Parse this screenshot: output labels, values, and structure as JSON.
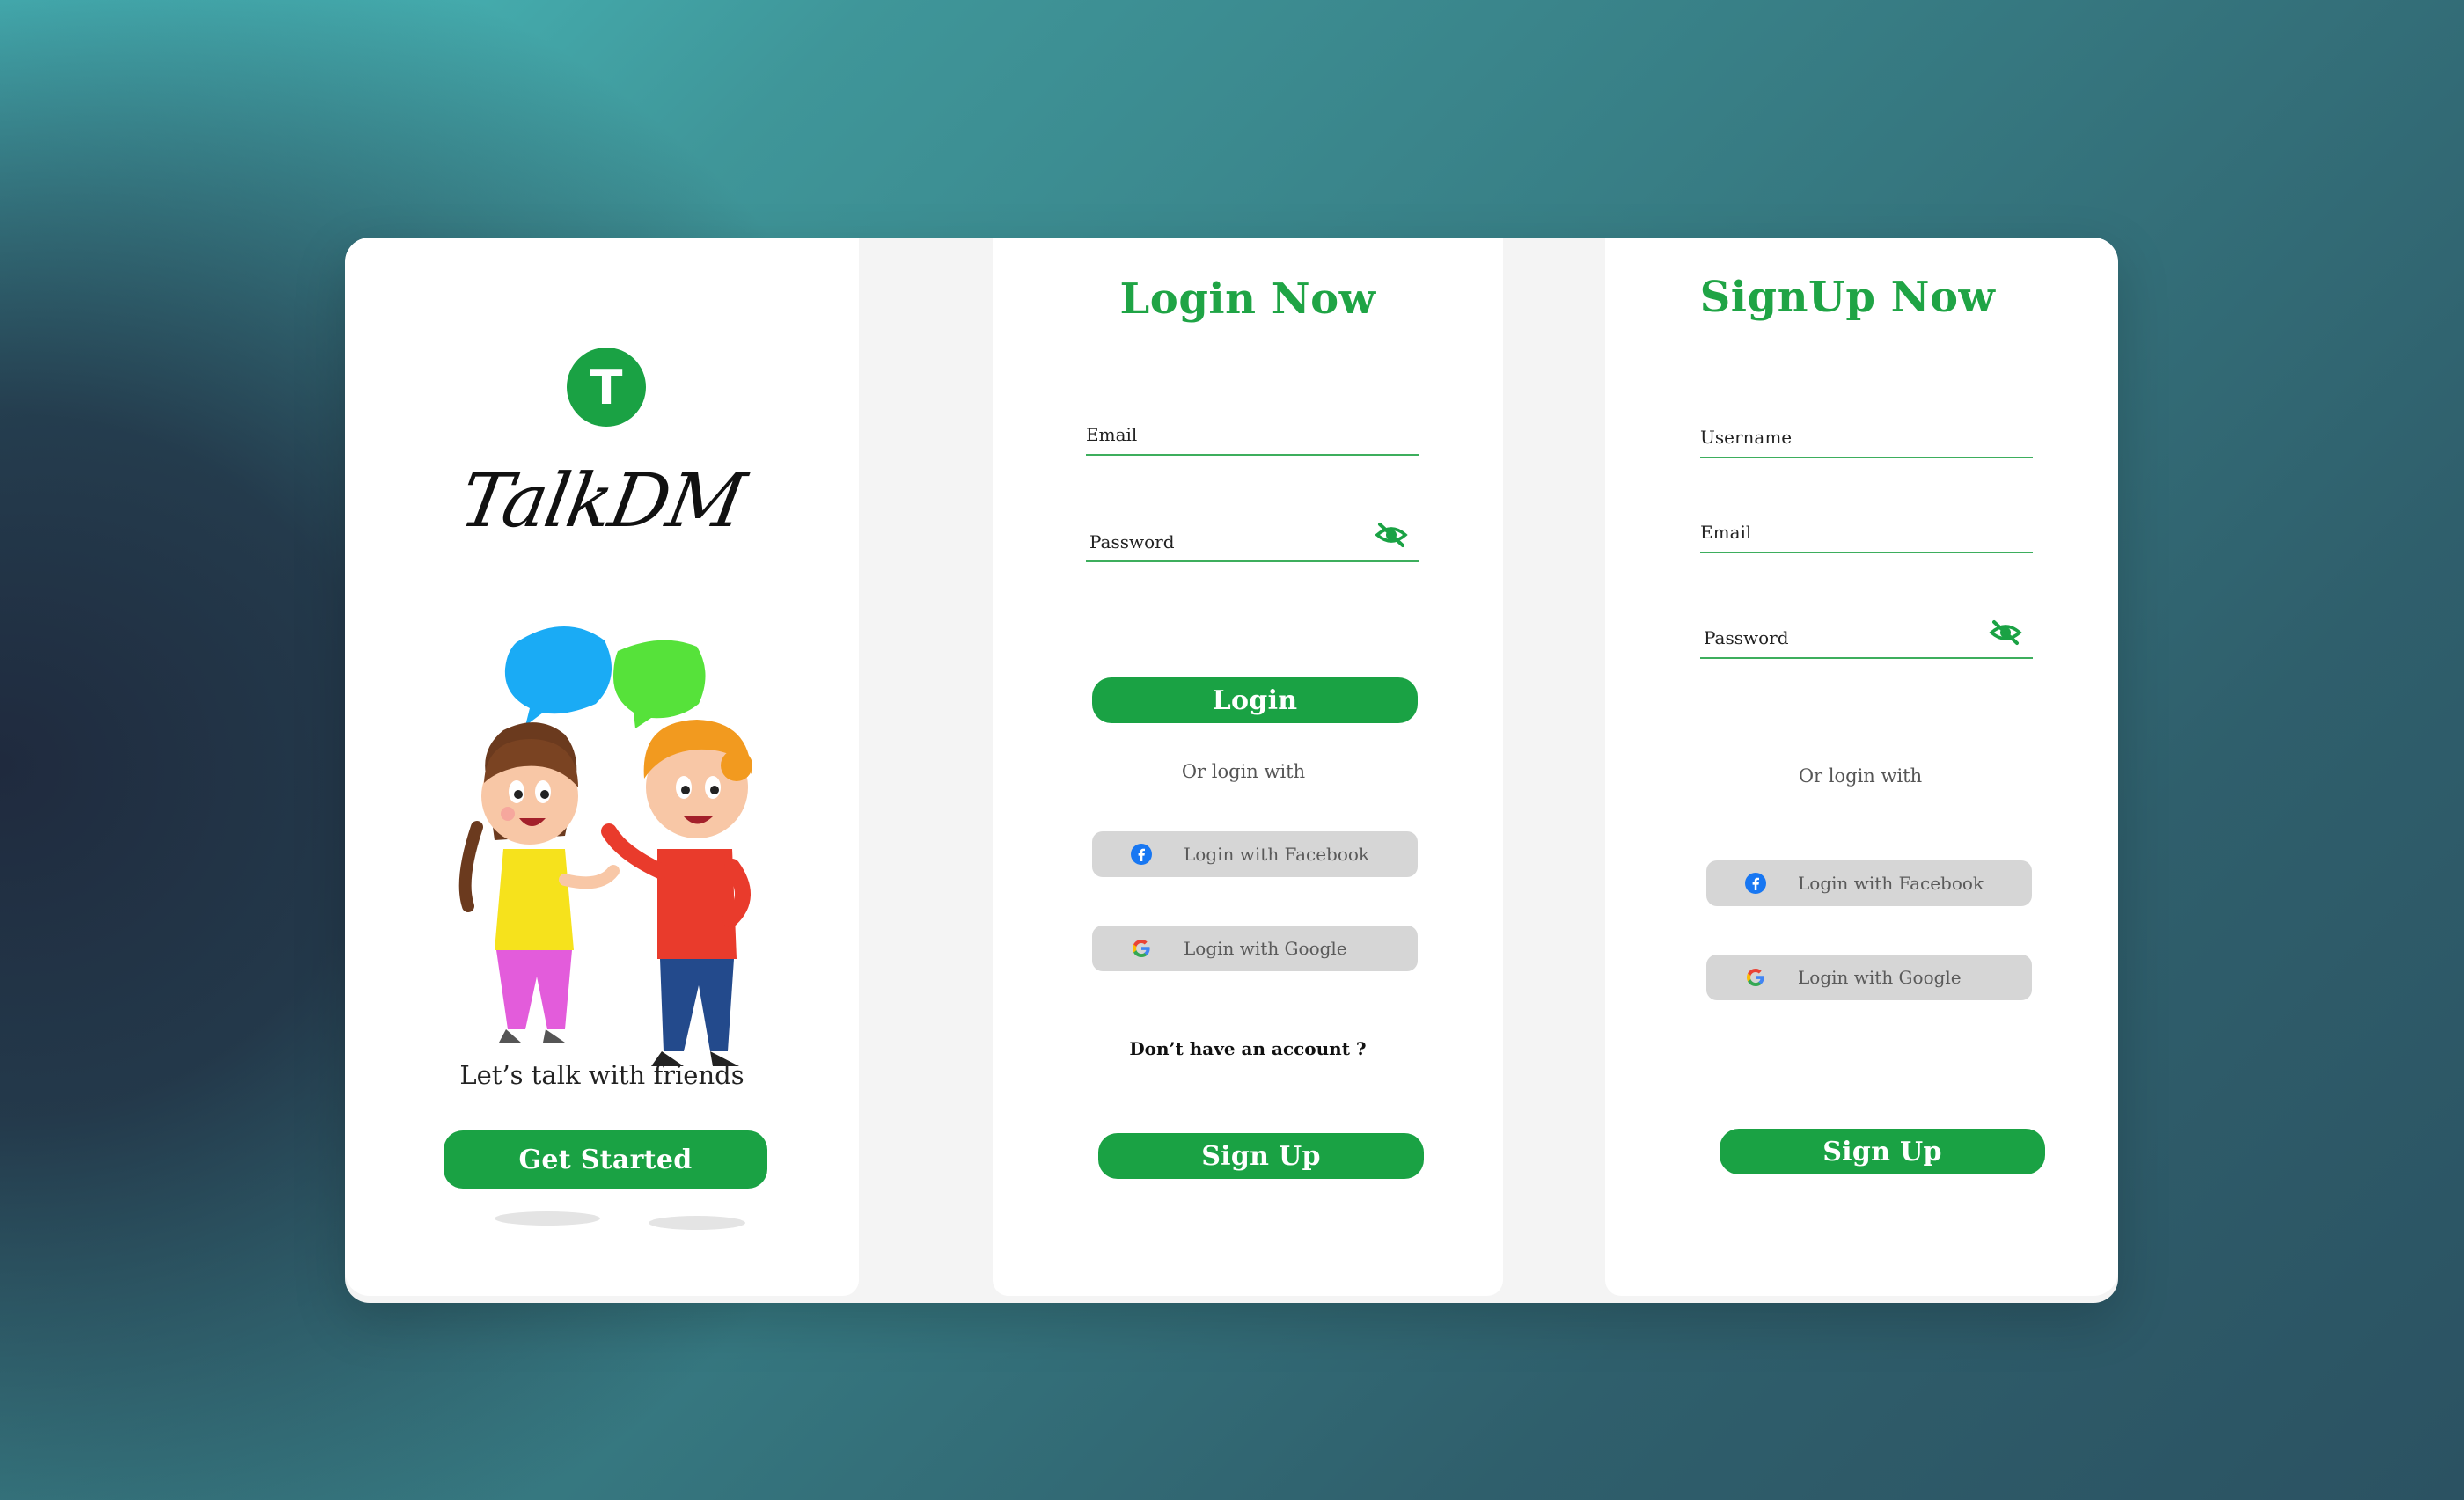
{
  "welcome": {
    "logo_letter": "T",
    "app_name": "TalkDM",
    "tagline": "Let’s talk with friends",
    "cta": "Get Started"
  },
  "login": {
    "title": "Login Now",
    "email_label": "Email",
    "password_label": "Password",
    "submit": "Login",
    "or_text": "Or login with",
    "facebook": "Login with Facebook",
    "google": "Login with Google",
    "no_account": "Don’t have an account ?",
    "signup": "Sign Up"
  },
  "signup": {
    "title": "SignUp Now",
    "username_label": "Username",
    "email_label": "Email",
    "password_label": "Password",
    "or_text": "Or login with",
    "facebook": "Login with Facebook",
    "google": "Login with Google",
    "submit": "Sign Up"
  },
  "colors": {
    "brand_green": "#1aa244",
    "facebook_blue": "#1877f2",
    "bubble_blue": "#1aabf5",
    "bubble_green": "#56e23a"
  },
  "icons": [
    "logo-icon",
    "eye-off-icon",
    "facebook-icon",
    "google-icon"
  ]
}
